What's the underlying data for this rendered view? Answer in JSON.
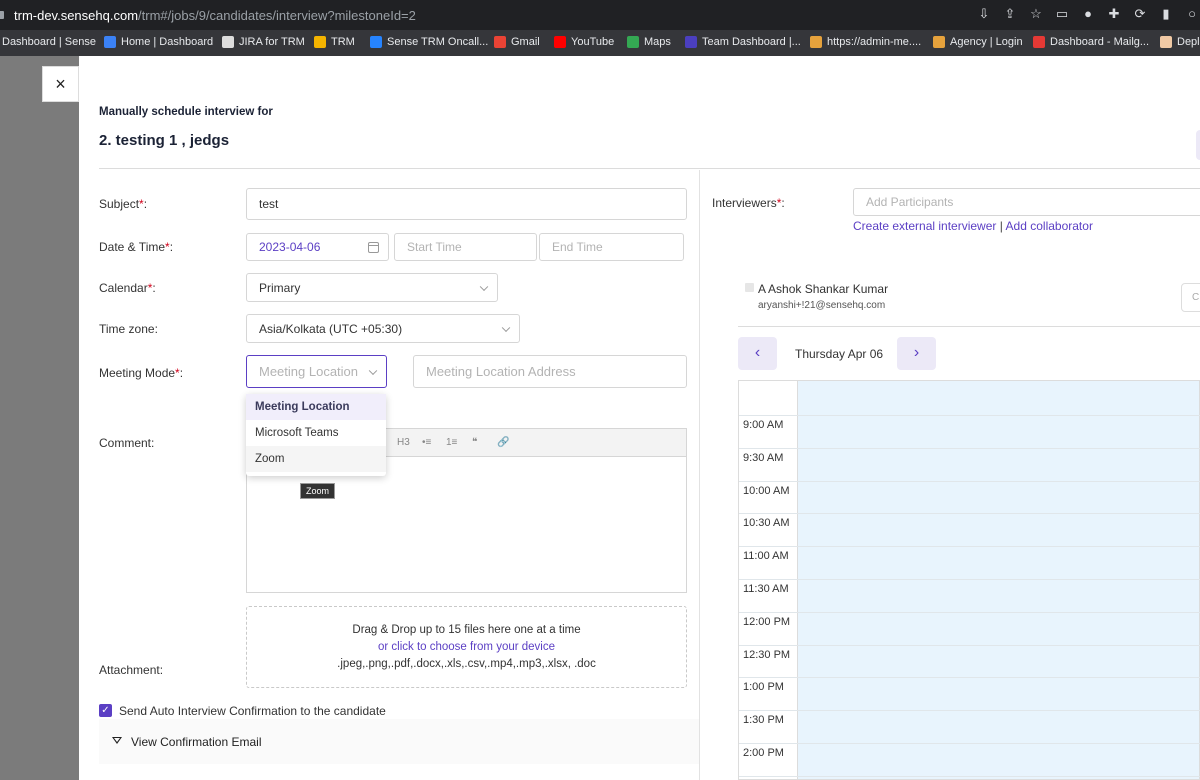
{
  "browser": {
    "url_host": "trm-dev.sensehq.com",
    "url_path": "/trm#/jobs/9/candidates/interview?milestoneId=2",
    "bookmarks": [
      {
        "label": "Dashboard | Sense",
        "color": "#ffffff"
      },
      {
        "label": "Home | Dashboard",
        "color": "#3b82f6"
      },
      {
        "label": "JIRA for TRM",
        "color": "#dddddd"
      },
      {
        "label": "TRM",
        "color": "#f4b400"
      },
      {
        "label": "Sense TRM Oncall...",
        "color": "#2684ff"
      },
      {
        "label": "Gmail",
        "color": "#ea4335"
      },
      {
        "label": "YouTube",
        "color": "#ff0000"
      },
      {
        "label": "Maps",
        "color": "#34a853"
      },
      {
        "label": "Team Dashboard |...",
        "color": "#4b3fbf"
      },
      {
        "label": "https://admin-me....",
        "color": "#e6a23c"
      },
      {
        "label": "Agency | Login",
        "color": "#e6a23c"
      },
      {
        "label": "Dashboard - Mailg...",
        "color": "#e53935"
      },
      {
        "label": "Depl",
        "color": "#f0c9a5"
      }
    ]
  },
  "dialog": {
    "close_label": "×",
    "subtitle": "Manually schedule interview for",
    "title": "2. testing 1 , jedgs"
  },
  "form": {
    "subject_label": "Subject",
    "subject_value": "test",
    "datetime_label": "Date & Time",
    "date_value": "2023-04-06",
    "start_time_placeholder": "Start Time",
    "end_time_placeholder": "End Time",
    "calendar_label": "Calendar",
    "calendar_value": "Primary",
    "timezone_label": "Time zone:",
    "timezone_value": "Asia/Kolkata (UTC +05:30)",
    "meeting_mode_label": "Meeting Mode",
    "meeting_mode_placeholder": "Meeting Location",
    "meeting_address_placeholder": "Meeting Location Address",
    "meeting_options": [
      "Meeting Location",
      "Microsoft Teams",
      "Zoom"
    ],
    "tooltip": "Zoom",
    "comment_label": "Comment:",
    "editor_tools": [
      "H3",
      "•≡",
      "1≡",
      "❝",
      "🔗"
    ],
    "attachment_label": "Attachment:",
    "dropzone_line1": "Drag & Drop up to 15 files here one at a time",
    "dropzone_line2": "or click to choose from your device",
    "dropzone_line3": ".jpeg,.png,.pdf,.docx,.xls,.csv,.mp4,.mp3,.xlsx, .doc",
    "auto_confirm_label": "Send Auto Interview Confirmation to the candidate",
    "auto_confirm_checked": true,
    "view_confirmation_label": "View Confirmation Email"
  },
  "right": {
    "interviewers_label": "Interviewers",
    "participants_placeholder": "Add Participants",
    "create_external_link": "Create external interviewer",
    "separator": "|",
    "add_collaborator_link": "Add collaborator",
    "person_name": "A Ashok Shankar Kumar",
    "person_email": "aryanshi+!21@sensehq.com",
    "person_btn": "C",
    "prev_label": "‹",
    "next_label": "›",
    "current_date": "Thursday Apr 06",
    "time_slots": [
      "9:00 AM",
      "9:30 AM",
      "10:00 AM",
      "10:30 AM",
      "11:00 AM",
      "11:30 AM",
      "12:00 PM",
      "12:30 PM",
      "1:00 PM",
      "1:30 PM",
      "2:00 PM"
    ]
  },
  "colors": {
    "accent": "#5b3fc4",
    "calendar_bg": "#e8f4fd",
    "required": "#d0021b"
  }
}
